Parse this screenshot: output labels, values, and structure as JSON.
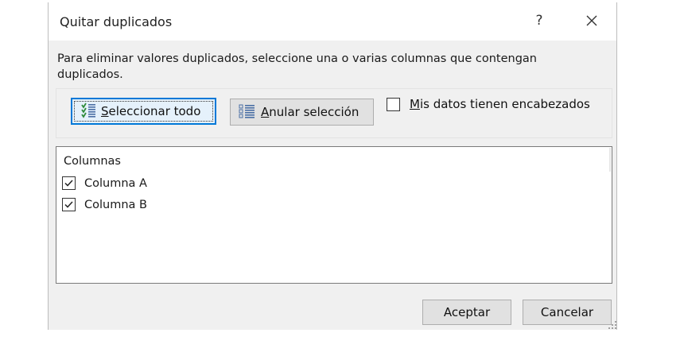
{
  "dialog": {
    "title": "Quitar duplicados",
    "help_label": "?",
    "close_icon": "close-icon"
  },
  "description": "Para eliminar valores duplicados, seleccione una o varias columnas que contengan duplicados.",
  "toolbar": {
    "select_all": {
      "accel": "S",
      "rest": "eleccionar todo",
      "icon": "select-all-list-icon"
    },
    "unselect_all": {
      "accel": "A",
      "rest": "nular selección",
      "icon": "unselect-list-icon"
    },
    "headers": {
      "accel": "M",
      "rest": "is datos tienen encabezados",
      "checked": false
    }
  },
  "columns": {
    "header": "Columnas",
    "items": [
      {
        "label": "Columna A",
        "checked": true
      },
      {
        "label": "Columna B",
        "checked": true
      }
    ]
  },
  "footer": {
    "ok_label": "Aceptar",
    "cancel_label": "Cancelar"
  },
  "colors": {
    "dialog_bg": "#f0f0f0",
    "focus_border": "#0078d7",
    "select_icon_green": "#2e8b3a",
    "list_icon_blue": "#4a6fa5"
  }
}
